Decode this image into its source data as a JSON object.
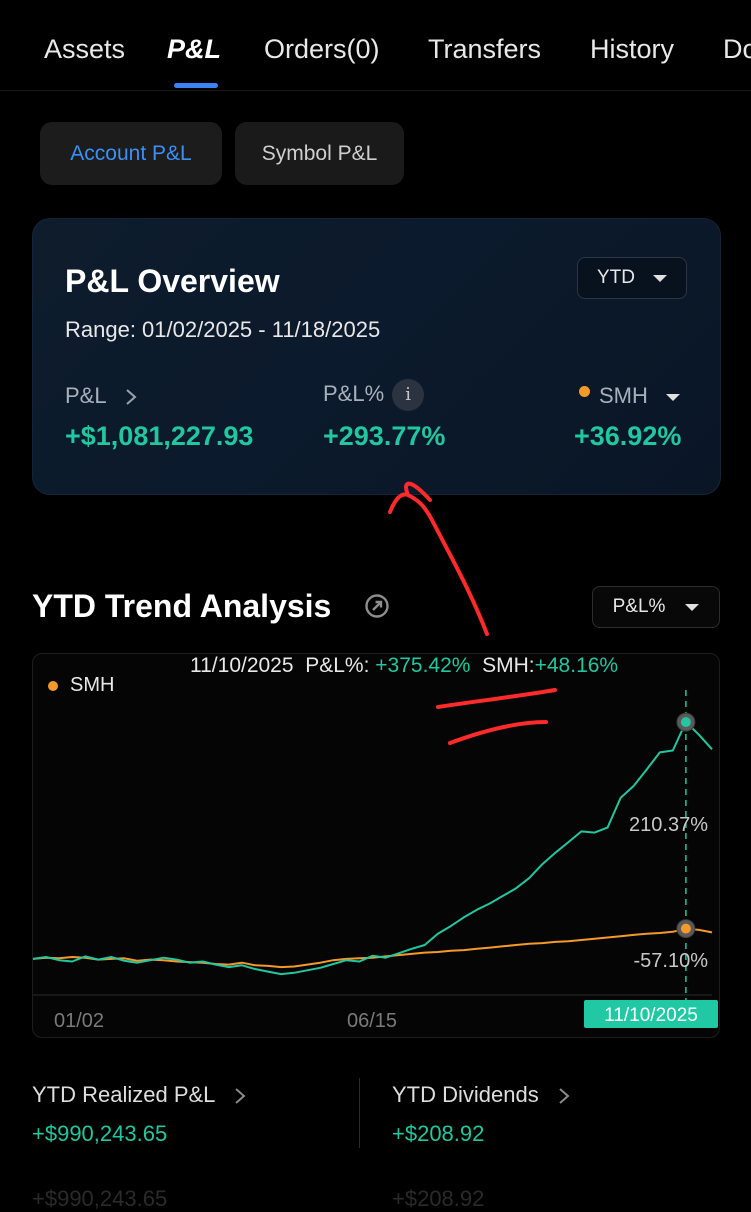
{
  "tabs": [
    "Assets",
    "P&L",
    "Orders(0)",
    "Transfers",
    "History",
    "Do"
  ],
  "segment": {
    "account": "Account P&L",
    "symbol": "Symbol P&L"
  },
  "overview": {
    "title": "P&L Overview",
    "range": "Range: 01/02/2025 - 11/18/2025",
    "period": "YTD",
    "pnl_label": "P&L",
    "pnl_value": "+$1,081,227.93",
    "pnl_pct_label": "P&L%",
    "info_glyph": "i",
    "pnl_pct_value": "+293.77%",
    "benchmark_label": "SMH",
    "benchmark_value": "+36.92%"
  },
  "trend": {
    "title": "YTD Trend Analysis",
    "metric": "P&L%",
    "tooltip": {
      "date": "11/10/2025",
      "pnl_label": "P&L%:",
      "pnl_value": "+375.42%",
      "smh_label": "SMH:",
      "smh_value": "+48.16%"
    },
    "legend": "SMH"
  },
  "chart_data": {
    "type": "line",
    "x_labels": [
      "01/02",
      "06/15",
      "11/10/2025"
    ],
    "y_labels": [
      "210.37%",
      "-57.10%"
    ],
    "ylim": [
      -57.1,
      410
    ],
    "series": [
      {
        "name": "P&L%",
        "color": "#22c7a0",
        "values": [
          0,
          3,
          -2,
          -4,
          4,
          -1,
          3,
          -3,
          -6,
          -2,
          2,
          -1,
          -6,
          -4,
          -9,
          -13,
          -10,
          -16,
          -20,
          -24,
          -22,
          -18,
          -14,
          -8,
          -2,
          -4,
          5,
          2,
          9,
          16,
          22,
          40,
          52,
          66,
          78,
          88,
          100,
          112,
          128,
          150,
          168,
          185,
          202,
          200,
          208,
          255,
          274,
          300,
          327,
          330,
          375,
          355,
          332
        ]
      },
      {
        "name": "SMH",
        "color": "#f39a2b",
        "values": [
          0,
          2,
          1,
          3,
          2,
          -1,
          0,
          1,
          -3,
          -1,
          -2,
          -4,
          -5,
          -6,
          -8,
          -9,
          -6,
          -10,
          -11,
          -13,
          -12,
          -9,
          -6,
          -2,
          0,
          1,
          2,
          4,
          6,
          8,
          10,
          11,
          13,
          14,
          16,
          18,
          20,
          22,
          24,
          25,
          27,
          28,
          30,
          32,
          34,
          36,
          38,
          40,
          41,
          43,
          48,
          46,
          42
        ]
      }
    ],
    "marker_index": 50
  },
  "stats": {
    "realized_label": "YTD Realized P&L",
    "realized_value": "+$990,243.65",
    "dividends_label": "YTD Dividends",
    "dividends_value": "+$208.92",
    "ghost_left": "+$990,243.65",
    "ghost_right": "+$208.92"
  },
  "colors": {
    "accent": "#3c8ff5",
    "positive": "#22c7a0",
    "benchmark": "#f39a2b",
    "annotation": "#ff2a2a"
  }
}
